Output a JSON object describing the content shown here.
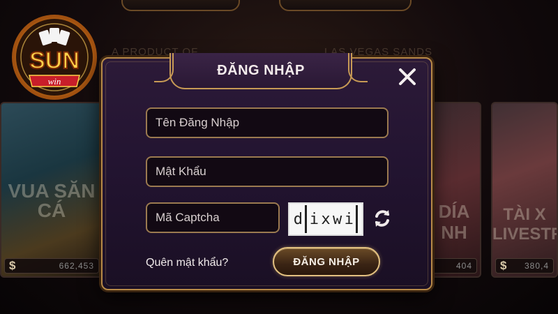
{
  "brand": {
    "logo_main": "SUN",
    "logo_sub": "win"
  },
  "background": {
    "product_left": "A PRODUCT OF",
    "product_right": "LAS VEGAS SANDS",
    "cards": [
      {
        "title": "VUA SĂN CÁ",
        "amount": "662,453"
      },
      {
        "title": "DÍA NH",
        "amount": "404"
      },
      {
        "title": "TÀI X LIVESTR",
        "amount": "380,4"
      }
    ]
  },
  "login_modal": {
    "title": "ĐĂNG NHẬP",
    "username_placeholder": "Tên Đăng Nhập",
    "password_placeholder": "Mật Khẩu",
    "captcha_placeholder": "Mã Captcha",
    "captcha_text": [
      "d",
      "i",
      "x",
      "w",
      "i"
    ],
    "forgot_password": "Quên mật khẩu?",
    "submit_label": "ĐĂNG NHẬP",
    "icons": {
      "close": "close-icon",
      "refresh": "refresh-icon",
      "currency": "dollar-icon"
    }
  },
  "colors": {
    "gold": "#c79a55",
    "modal_bg": "#231431",
    "field_bg": "#120913"
  }
}
